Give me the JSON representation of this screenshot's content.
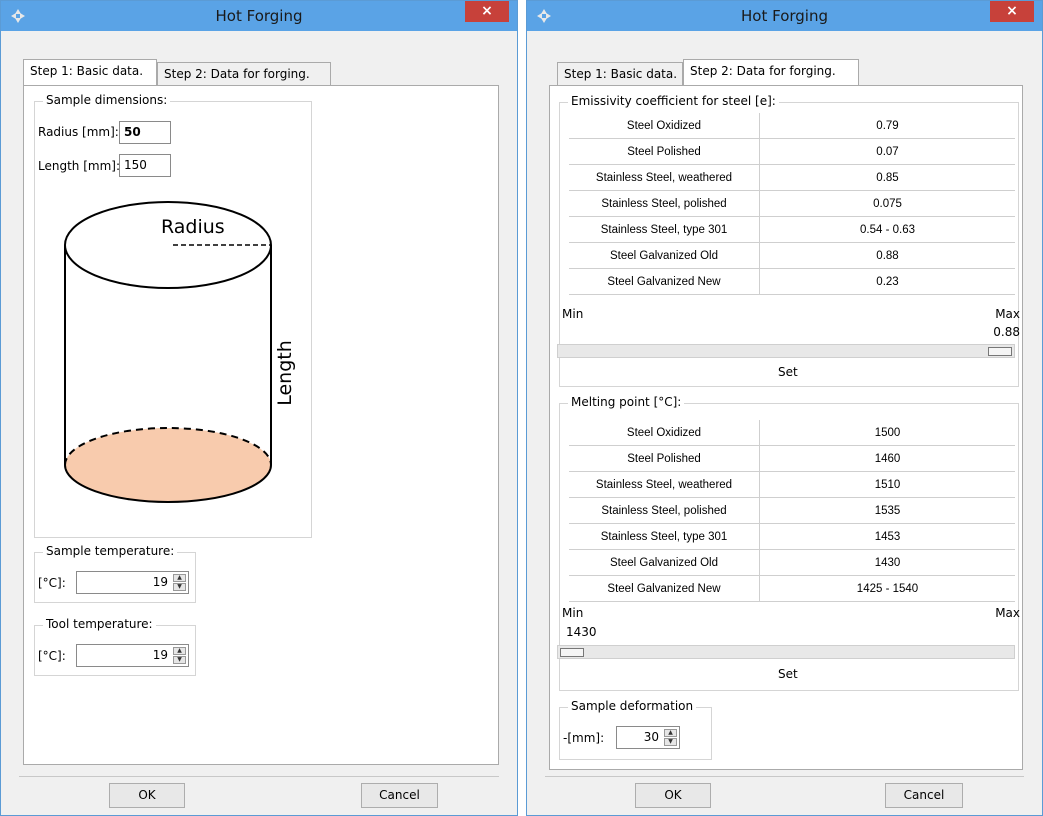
{
  "windows": [
    {
      "title": "Hot Forging",
      "close_label": "×",
      "tabs": [
        "Step 1: Basic data.",
        "Step 2: Data for forging."
      ],
      "active_tab": 0,
      "sample_dimensions": {
        "label": "Sample dimensions:",
        "radius_label": "Radius [mm]:",
        "radius_value": "50",
        "length_label": "Length [mm]:",
        "length_value": "150",
        "diagram": {
          "radius_text": "Radius",
          "length_text": "Length",
          "base_fill": "#f8cbad"
        }
      },
      "sample_temperature": {
        "label": "Sample temperature:",
        "unit": "[°C]:",
        "value": "19"
      },
      "tool_temperature": {
        "label": "Tool temperature:",
        "unit": "[°C]:",
        "value": "19"
      },
      "ok_label": "OK",
      "cancel_label": "Cancel"
    },
    {
      "title": "Hot Forging",
      "close_label": "×",
      "tabs": [
        "Step 1: Basic data.",
        "Step 2: Data for forging."
      ],
      "active_tab": 1,
      "emissivity": {
        "label": "Emissivity coefficient for steel [e]:",
        "rows": [
          [
            "Steel Oxidized",
            "0.79"
          ],
          [
            "Steel Polished",
            "0.07"
          ],
          [
            "Stainless Steel, weathered",
            "0.85"
          ],
          [
            "Stainless Steel, polished",
            "0.075"
          ],
          [
            "Stainless Steel, type 301",
            "0.54 - 0.63"
          ],
          [
            "Steel Galvanized Old",
            "0.88"
          ],
          [
            "Steel Galvanized New",
            "0.23"
          ]
        ],
        "min_label": "Min",
        "max_label": "Max",
        "value": "0.88",
        "slider_fraction": 1.0,
        "set_label": "Set"
      },
      "melting_point": {
        "label": "Melting point [°C]:",
        "rows": [
          [
            "Steel Oxidized",
            "1500"
          ],
          [
            "Steel Polished",
            "1460"
          ],
          [
            "Stainless Steel, weathered",
            "1510"
          ],
          [
            "Stainless Steel, polished",
            "1535"
          ],
          [
            "Stainless Steel, type 301",
            "1453"
          ],
          [
            "Steel Galvanized Old",
            "1430"
          ],
          [
            "Steel Galvanized New",
            "1425 - 1540"
          ]
        ],
        "min_label": "Min",
        "max_label": "Max",
        "value": "1430",
        "slider_fraction": 0.0,
        "set_label": "Set"
      },
      "sample_deformation": {
        "label": "Sample deformation",
        "unit": "-[mm]:",
        "value": "30"
      },
      "ok_label": "OK",
      "cancel_label": "Cancel"
    }
  ],
  "colors": {
    "titlebar": "#5aa3e6",
    "close": "#c7413a",
    "window_border": "#5b9bd5"
  }
}
